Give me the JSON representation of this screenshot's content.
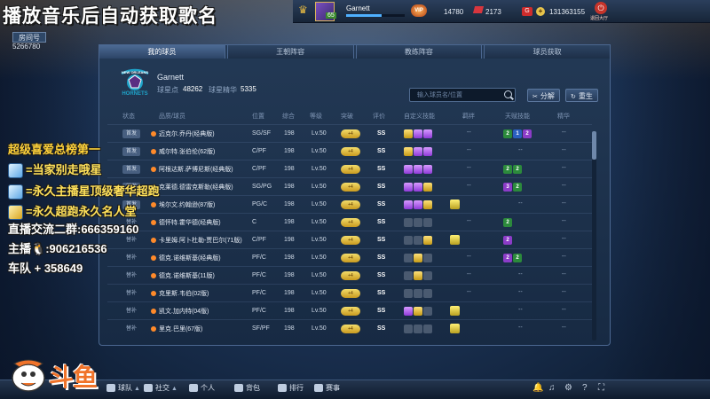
{
  "stream_overlay": {
    "title": "播放音乐后自动获取歌名",
    "room_label": "房间号",
    "room_number": "5266780",
    "rank_title": "超级喜爱总榜第一",
    "lines": [
      {
        "text": "=当家别走哦星"
      },
      {
        "text": "=永久主播星顶级奢华超跑"
      },
      {
        "text": "=永久超跑永久名人堂"
      }
    ],
    "qq_group": "直播交流二群:666359160",
    "host_qq": "主播",
    "host_qq_number": ":906216536",
    "team_id": "车队 + 358649"
  },
  "topbar": {
    "player_name": "Garnett",
    "avatar_level": "65",
    "xp_percent": 60,
    "vip_label": "VIP",
    "coins": "14780",
    "tickets": "2173",
    "gold_icon_label": "G",
    "gold_plus": "+",
    "gold": "131363155",
    "exit_label": "退回大厅"
  },
  "tabs": [
    {
      "label": "我的球员",
      "active": true
    },
    {
      "label": "王朝阵容",
      "active": false
    },
    {
      "label": "教练阵容",
      "active": false
    },
    {
      "label": "球员获取",
      "active": false
    }
  ],
  "team": {
    "logo_text": "NEW ORLEANS HORNETS",
    "name": "Garnett",
    "score_label": "球星点",
    "score": "48262",
    "elite_label": "球星精华",
    "elite": "5335"
  },
  "toolbar": {
    "search_placeholder": "输入球员名/位置",
    "decompose_label": "分解",
    "rebirth_label": "重生"
  },
  "columns": [
    "状态",
    "品质/球员",
    "位置",
    "综合",
    "等级",
    "突破",
    "评价",
    "自定义技能",
    "羁绊",
    "天赋技能",
    "精华"
  ],
  "players": [
    {
      "status": "首发",
      "name": "迈克尔.乔丹(经典版)",
      "pos": "SG/SF",
      "ovr": "198",
      "lv": "Lv.50",
      "break": "+4",
      "grade": "SS",
      "skills": [
        "gold",
        "purple",
        "purple"
      ],
      "bond": "--",
      "talent": [
        {
          "t": "g",
          "v": "2"
        },
        {
          "t": "b",
          "v": "1"
        },
        {
          "t": "p",
          "v": "2"
        }
      ],
      "essence": "--"
    },
    {
      "status": "首发",
      "name": "威尔特.张伯伦(62版)",
      "pos": "C/PF",
      "ovr": "198",
      "lv": "Lv.50",
      "break": "+4",
      "grade": "SS",
      "skills": [
        "gold",
        "purple",
        "purple"
      ],
      "bond": "--",
      "talent": [],
      "essence": "--"
    },
    {
      "status": "首发",
      "name": "阿根达斯.萨博尼斯(经典版)",
      "pos": "C/PF",
      "ovr": "198",
      "lv": "Lv.50",
      "break": "+4",
      "grade": "SS",
      "skills": [
        "purple",
        "purple",
        "purple"
      ],
      "bond": "--",
      "talent": [
        {
          "t": "g",
          "v": "2"
        },
        {
          "t": "g",
          "v": "2"
        }
      ],
      "essence": "--"
    },
    {
      "status": "首发",
      "name": "克莱德.德雷克斯勒(经典版)",
      "pos": "SG/PG",
      "ovr": "198",
      "lv": "Lv.50",
      "break": "+4",
      "grade": "SS",
      "skills": [
        "purple",
        "purple",
        "gold"
      ],
      "bond": "--",
      "talent": [
        {
          "t": "p",
          "v": "3"
        },
        {
          "t": "g",
          "v": "2"
        }
      ],
      "essence": "--"
    },
    {
      "status": "首发",
      "name": "埃尔文.约翰逊(87版)",
      "pos": "PG/C",
      "ovr": "198",
      "lv": "Lv.50",
      "break": "+4",
      "grade": "SS",
      "skills": [
        "purple",
        "purple",
        "gold"
      ],
      "bond": "",
      "talent": [],
      "essence": "--"
    },
    {
      "status": "替补",
      "name": "德怀特.霍华德(经典版)",
      "pos": "C",
      "ovr": "198",
      "lv": "Lv.50",
      "break": "+4",
      "grade": "SS",
      "skills": [
        "gray",
        "gray",
        "gray"
      ],
      "bond": "--",
      "talent": [
        {
          "t": "g",
          "v": "2"
        }
      ],
      "essence": "--"
    },
    {
      "status": "替补",
      "name": "卡里姆.阿卜杜勒-贾巴尔(71版)",
      "pos": "C/PF",
      "ovr": "198",
      "lv": "Lv.50",
      "break": "+4",
      "grade": "SS",
      "skills": [
        "gray",
        "gray",
        "gold"
      ],
      "bond": "",
      "talent": [
        {
          "t": "p",
          "v": "2"
        }
      ],
      "essence": "--"
    },
    {
      "status": "替补",
      "name": "德克.诺维斯基(经典版)",
      "pos": "PF/C",
      "ovr": "198",
      "lv": "Lv.50",
      "break": "+4",
      "grade": "SS",
      "skills": [
        "gray",
        "gold",
        "gray"
      ],
      "bond": "--",
      "talent": [
        {
          "t": "p",
          "v": "2"
        },
        {
          "t": "g",
          "v": "2"
        }
      ],
      "essence": "--"
    },
    {
      "status": "替补",
      "name": "德克.诺维斯基(11版)",
      "pos": "PF/C",
      "ovr": "198",
      "lv": "Lv.50",
      "break": "+4",
      "grade": "SS",
      "skills": [
        "gray",
        "gold",
        "gray"
      ],
      "bond": "--",
      "talent": [],
      "essence": "--"
    },
    {
      "status": "替补",
      "name": "克里斯.韦伯(02版)",
      "pos": "PF/C",
      "ovr": "198",
      "lv": "Lv.50",
      "break": "+4",
      "grade": "SS",
      "skills": [
        "gray",
        "gray",
        "gray"
      ],
      "bond": "--",
      "talent": [],
      "essence": "--"
    },
    {
      "status": "替补",
      "name": "凯文.加内特(04版)",
      "pos": "PF/C",
      "ovr": "198",
      "lv": "Lv.50",
      "break": "+4",
      "grade": "SS",
      "skills": [
        "purple",
        "gold",
        "gray"
      ],
      "bond": "",
      "talent": [],
      "essence": "--"
    },
    {
      "status": "替补",
      "name": "里克.巴里(67版)",
      "pos": "SF/PF",
      "ovr": "198",
      "lv": "Lv.50",
      "break": "+4",
      "grade": "SS",
      "skills": [
        "gray",
        "gray",
        "gray"
      ],
      "bond": "",
      "talent": [],
      "essence": "--"
    }
  ],
  "bottom_nav": [
    {
      "label": "球队",
      "icon": "team-icon"
    },
    {
      "label": "社交",
      "icon": "social-icon"
    },
    {
      "label": "个人",
      "icon": "person-icon"
    },
    {
      "label": "背包",
      "icon": "bag-icon"
    },
    {
      "label": "排行",
      "icon": "rank-icon"
    },
    {
      "label": "赛事",
      "icon": "trophy-icon"
    }
  ],
  "logo": {
    "text": "斗鱼"
  }
}
